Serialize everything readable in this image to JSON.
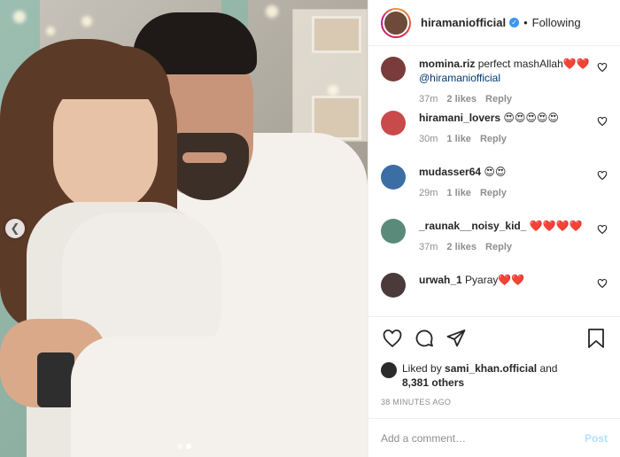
{
  "post": {
    "username": "hiramaniofficial",
    "follow_status": "Following",
    "separator": "•",
    "carousel": {
      "current_index": 2,
      "total": 2
    }
  },
  "comments": [
    {
      "user": "momina.riz",
      "text": "perfect mashAllah❤️❤️",
      "mention": "@hiramaniofficial",
      "time": "37m",
      "likes": "2 likes",
      "reply": "Reply",
      "avatar_color": "#7a3b3b"
    },
    {
      "user": "hiramani_lovers",
      "text": "😍😍😍😍😍",
      "mention": "",
      "time": "30m",
      "likes": "1 like",
      "reply": "Reply",
      "avatar_color": "#c94a4a"
    },
    {
      "user": "mudasser64",
      "text": "😍😍",
      "mention": "",
      "time": "29m",
      "likes": "1 like",
      "reply": "Reply",
      "avatar_color": "#3a6ea5"
    },
    {
      "user": "_raunak__noisy_kid_",
      "text": "❤️❤️❤️❤️",
      "mention": "",
      "time": "37m",
      "likes": "2 likes",
      "reply": "Reply",
      "avatar_color": "#5a8a7a"
    },
    {
      "user": "urwah_1",
      "text": "Pyaray❤️❤️",
      "mention": "",
      "time": "",
      "likes": "",
      "reply": "",
      "avatar_color": "#4a3a3a"
    }
  ],
  "actions": {
    "like_icon": "heart-icon",
    "comment_icon": "comment-icon",
    "share_icon": "share-icon",
    "save_icon": "bookmark-icon"
  },
  "likes": {
    "prefix": "Liked by",
    "user": "sami_khan.official",
    "conjunction": "and",
    "others": "8,381 others"
  },
  "timestamp": "38 MINUTES AGO",
  "add_comment": {
    "placeholder": "Add a comment…",
    "post_label": "Post"
  },
  "colors": {
    "accent": "#3897f0",
    "post_disabled": "#b2dffc",
    "muted": "#8e8e8e"
  }
}
